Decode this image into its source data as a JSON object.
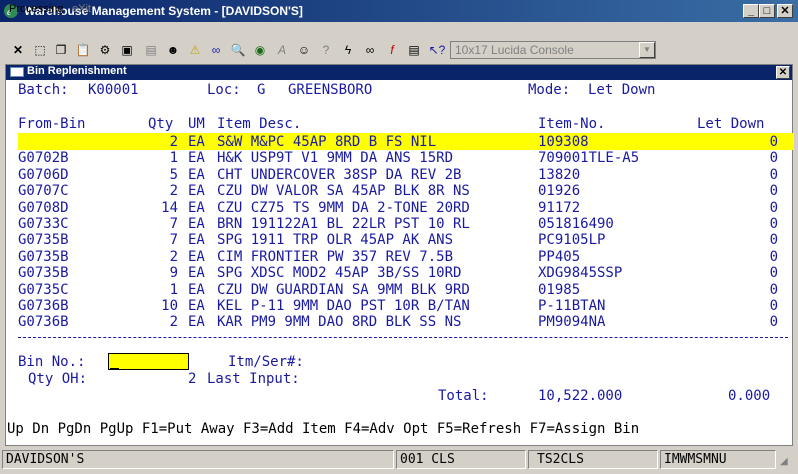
{
  "window": {
    "title": "Warehouse Management System - [DAVIDSON'S]"
  },
  "menu": {
    "processing": "Processing",
    "exit": "eXit"
  },
  "toolbar": {
    "font_select": "10x17 Lucida Console"
  },
  "form": {
    "title": "Bin Replenishment",
    "batch_label": "Batch:",
    "batch_value": "K00001",
    "loc_label": "Loc:",
    "loc_code": "G",
    "loc_name": "GREENSBORO",
    "mode_label": "Mode:",
    "mode_value": "Let Down"
  },
  "table": {
    "headers": {
      "from_bin": "From-Bin",
      "qty": "Qty",
      "um": "UM",
      "desc": "Item Desc.",
      "item_no": "Item-No.",
      "let_down": "Let Down"
    },
    "rows": [
      {
        "from_bin": "",
        "qty": "2",
        "um": "EA",
        "desc": "S&W M&PC 45AP 8RD B FS NIL",
        "item_no": "109308",
        "let_down": "0"
      },
      {
        "from_bin": "G0702B",
        "qty": "1",
        "um": "EA",
        "desc": "H&K USP9T V1 9MM DA ANS 15RD",
        "item_no": "709001TLE-A5",
        "let_down": "0"
      },
      {
        "from_bin": "G0706D",
        "qty": "5",
        "um": "EA",
        "desc": "CHT UNDERCOVER 38SP DA REV 2B",
        "item_no": "13820",
        "let_down": "0"
      },
      {
        "from_bin": "G0707C",
        "qty": "2",
        "um": "EA",
        "desc": "CZU DW VALOR SA 45AP BLK 8R NS",
        "item_no": "01926",
        "let_down": "0"
      },
      {
        "from_bin": "G0708D",
        "qty": "14",
        "um": "EA",
        "desc": "CZU CZ75 TS 9MM DA 2-TONE 20RD",
        "item_no": "91172",
        "let_down": "0"
      },
      {
        "from_bin": "G0733C",
        "qty": "7",
        "um": "EA",
        "desc": "BRN 191122A1 BL 22LR PST 10 RL",
        "item_no": "051816490",
        "let_down": "0"
      },
      {
        "from_bin": "G0735B",
        "qty": "7",
        "um": "EA",
        "desc": "SPG 1911 TRP OLR 45AP AK ANS",
        "item_no": "PC9105LP",
        "let_down": "0"
      },
      {
        "from_bin": "G0735B",
        "qty": "2",
        "um": "EA",
        "desc": "CIM FRONTIER PW 357 REV 7.5B",
        "item_no": "PP405",
        "let_down": "0"
      },
      {
        "from_bin": "G0735B",
        "qty": "9",
        "um": "EA",
        "desc": "SPG XDSC MOD2 45AP 3B/SS 10RD",
        "item_no": "XDG9845SSP",
        "let_down": "0"
      },
      {
        "from_bin": "G0735C",
        "qty": "1",
        "um": "EA",
        "desc": "CZU DW GUARDIAN SA 9MM BLK 9RD",
        "item_no": "01985",
        "let_down": "0"
      },
      {
        "from_bin": "G0736B",
        "qty": "10",
        "um": "EA",
        "desc": "KEL P-11 9MM DAO PST 10R B/TAN",
        "item_no": "P-11BTAN",
        "let_down": "0"
      },
      {
        "from_bin": "G0736B",
        "qty": "2",
        "um": "EA",
        "desc": "KAR PM9 9MM DAO 8RD BLK SS NS",
        "item_no": "PM9094NA",
        "let_down": "0"
      }
    ]
  },
  "entry": {
    "bin_label": "Bin No.:",
    "bin_value": "",
    "itm_ser_label": "Itm/Ser#:",
    "qty_oh_label": "Qty OH:",
    "qty_oh_value": "2",
    "last_input_label": "Last Input:",
    "total_label": "Total:",
    "total_value": "10,522.000",
    "total_let_down": "0.000"
  },
  "function_keys": "Up Dn PgDn PgUp F1=Put Away F3=Add Item F4=Adv Opt F5=Refresh F7=Assign Bin",
  "status": {
    "company": "DAVIDSON'S",
    "code": "001 CLS",
    "session": "TS2CLS",
    "module": "IMWMSMNU"
  }
}
